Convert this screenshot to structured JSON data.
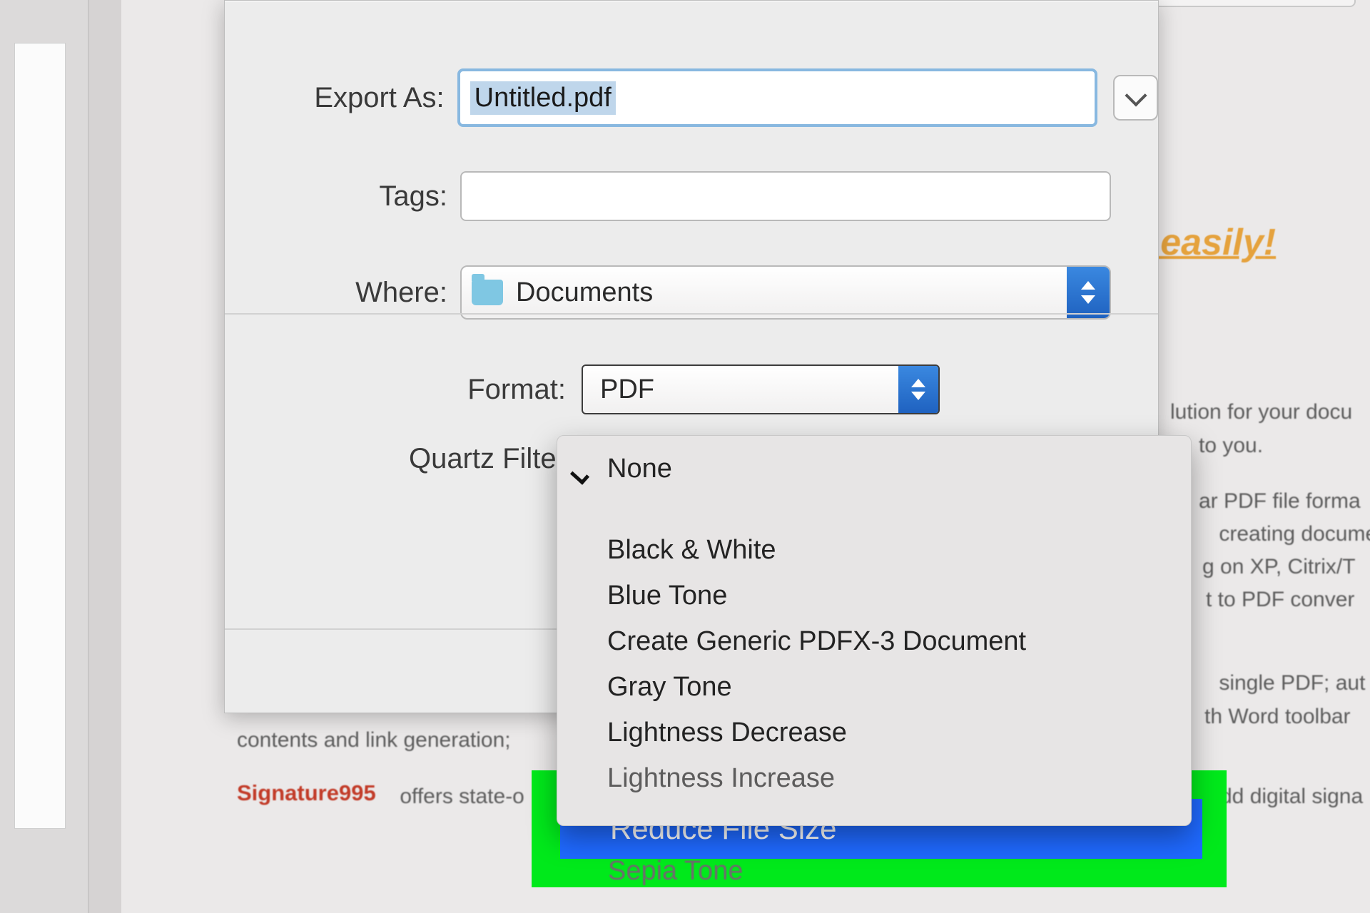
{
  "dialog": {
    "labels": {
      "export_as": "Export As:",
      "tags": "Tags:",
      "where": "Where:",
      "format": "Format:",
      "quartz_filter": "Quartz Filter"
    },
    "export_filename": "Untitled.pdf",
    "tags_value": "",
    "where_value": "Documents",
    "format_value": "PDF",
    "quartz_filter_selected": "None",
    "quartz_filter_options": [
      "None",
      "Black & White",
      "Blue Tone",
      "Create Generic PDFX-3 Document",
      "Gray Tone",
      "Lightness Decrease",
      "Lightness Increase",
      "Reduce File Size",
      "Sepia Tone"
    ],
    "highlighted_option": "Reduce File Size"
  },
  "background": {
    "heading_fragment": "d easily!",
    "line1": "lution for your docu",
    "line2": "to you.",
    "line3": "ar PDF file forma",
    "line4": " creating docume",
    "line5": "g on XP, Citrix/T",
    "line6": "t to PDF conver",
    "line7": " single PDF; aut",
    "line8": "th Word toolbar",
    "contents_line": "contents and link generation;",
    "sig_label": "Signature995",
    "sig_rest": " offers state-o",
    "sig_tail": "dd digital signa"
  }
}
